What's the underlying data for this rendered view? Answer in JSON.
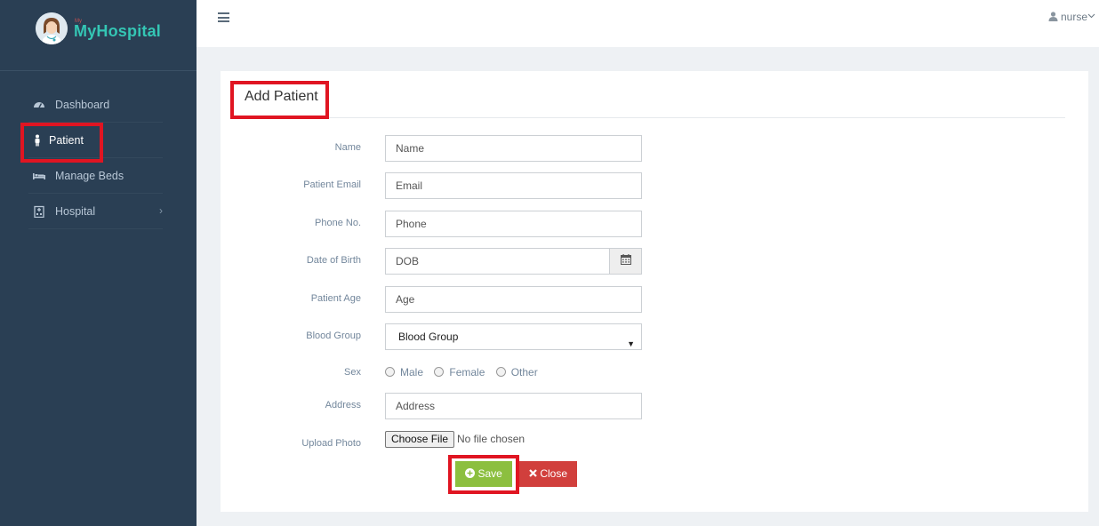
{
  "brand": {
    "name": "MyHospital",
    "small": "My"
  },
  "sidebar": {
    "items": [
      {
        "label": "Dashboard",
        "icon": "dashboard-icon"
      },
      {
        "label": "Patient",
        "icon": "patient-icon"
      },
      {
        "label": "Manage Beds",
        "icon": "bed-icon"
      },
      {
        "label": "Hospital",
        "icon": "hospital-icon",
        "chevron": "›"
      }
    ]
  },
  "topbar": {
    "user": "nurse"
  },
  "form": {
    "title": "Add Patient",
    "fields": {
      "name": {
        "label": "Name",
        "placeholder": "Name"
      },
      "email": {
        "label": "Patient Email",
        "placeholder": "Email"
      },
      "phone": {
        "label": "Phone No.",
        "placeholder": "Phone"
      },
      "dob": {
        "label": "Date of Birth",
        "placeholder": "DOB"
      },
      "age": {
        "label": "Patient Age",
        "placeholder": "Age"
      },
      "blood": {
        "label": "Blood Group",
        "selected": "Blood Group"
      },
      "sex": {
        "label": "Sex",
        "options": [
          "Male",
          "Female",
          "Other"
        ]
      },
      "address": {
        "label": "Address",
        "placeholder": "Address"
      },
      "photo": {
        "label": "Upload Photo",
        "button": "Choose File",
        "status": "No file chosen"
      }
    },
    "save_label": "Save",
    "close_label": "Close"
  },
  "colors": {
    "sidebar": "#2a3f54",
    "save": "#8cbf3f",
    "close": "#d13f3c",
    "highlight": "#e01522",
    "brand": "#34c6b4"
  }
}
